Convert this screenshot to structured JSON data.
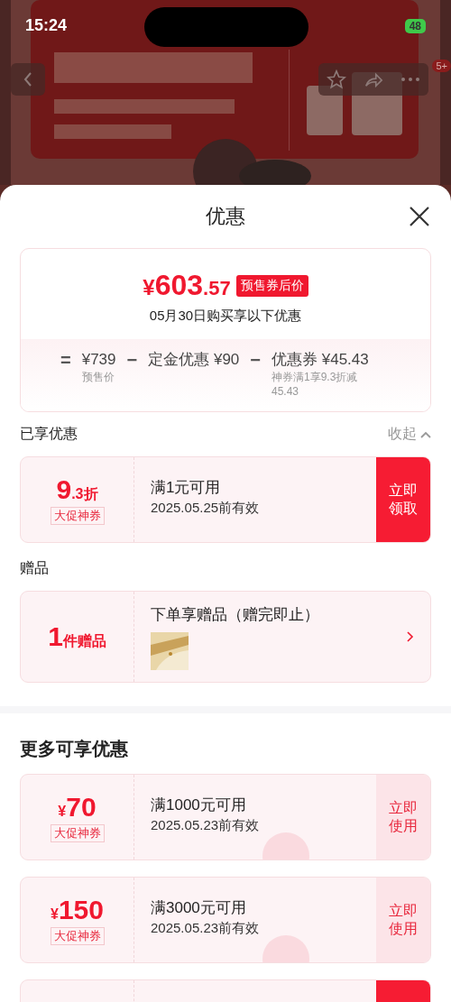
{
  "status_bar": {
    "time": "15:24",
    "battery": "48"
  },
  "header": {
    "badge": "5+"
  },
  "sheet": {
    "title": "优惠",
    "summary": {
      "currency": "¥",
      "price_int": "603",
      "price_dec": ".57",
      "tag": "预售券后价",
      "note": "05月30日购买享以下优惠",
      "terms": [
        {
          "operator": "=",
          "amount": "¥739",
          "caption": "预售价"
        },
        {
          "operator": "−",
          "label": "定金优惠",
          "amount": "¥90"
        },
        {
          "operator": "−",
          "label": "优惠券",
          "amount": "¥45.43",
          "caption": "神券满1享9.3折减45.43"
        }
      ]
    },
    "applied": {
      "title": "已享优惠",
      "toggle": "收起",
      "expanded": true,
      "coupons": [
        {
          "kind": "discount",
          "value": "9",
          "unit": ".3折",
          "tag": "大促神券",
          "condition": "满1元可用",
          "validity": "2025.05.25前有效",
          "action": [
            "立即",
            "领取"
          ],
          "claimed": false
        }
      ]
    },
    "gift": {
      "title": "赠品",
      "count": "1",
      "unit": "件赠品",
      "name": "下单享赠品（赠完即止）"
    },
    "more": {
      "title": "更多可享优惠",
      "coupons": [
        {
          "kind": "amount",
          "currency": "¥",
          "value": "70",
          "tag": "大促神券",
          "condition": "满1000元可用",
          "validity": "2025.05.23前有效",
          "action": [
            "立即",
            "使用"
          ],
          "claimed": true
        },
        {
          "kind": "amount",
          "currency": "¥",
          "value": "150",
          "tag": "大促神券",
          "condition": "满3000元可用",
          "validity": "2025.05.23前有效",
          "action": [
            "立即",
            "使用"
          ],
          "claimed": true
        },
        {
          "kind": "partial",
          "claimed": false
        }
      ]
    }
  }
}
